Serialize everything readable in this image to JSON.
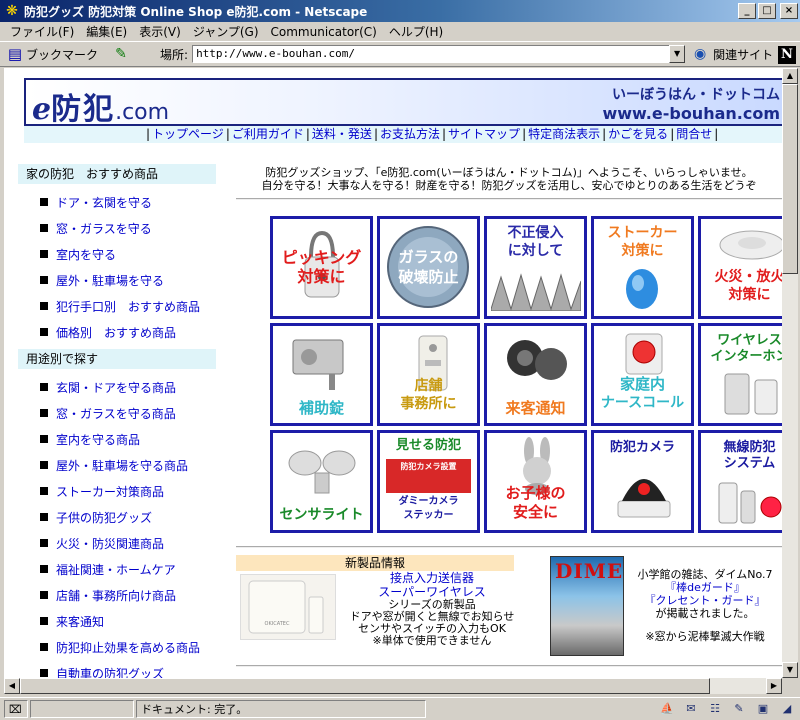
{
  "window": {
    "title": "防犯グッズ 防犯対策 Online Shop e防犯.com - Netscape",
    "minimize": "_",
    "maximize": "□",
    "close": "×"
  },
  "menu": [
    "ファイル(F)",
    "編集(E)",
    "表示(V)",
    "ジャンプ(G)",
    "Communicator(C)",
    "ヘルプ(H)"
  ],
  "toolbar": {
    "bookmarks_label": "ブックマーク",
    "location_label": "場所:",
    "url": "http://www.e-bouhan.com/",
    "related_label": "関連サイト",
    "brand_logo": "N"
  },
  "status": {
    "text": "ドキュメント: 完了。"
  },
  "page": {
    "logo_e": "e",
    "logo_kanji": "防犯",
    "logo_com": ".com",
    "header_kana": "いーぼうはん・ドットコム",
    "header_url": "www.e-bouhan.com",
    "nav": [
      "トップページ",
      "ご利用ガイド",
      "送料・発送",
      "お支払方法",
      "サイトマップ",
      "特定商法表示",
      "かごを見る",
      "問合せ"
    ],
    "welcome_line1": "防犯グッズショップ、「e防犯.com(いーぼうはん・ドットコム)」へようこそ、いらっしゃいませ。",
    "welcome_line2": "自分を守る！大事な人を守る！財産を守る！防犯グッズを活用し、安心でゆとりのある生活をどうぞ",
    "sidebar": {
      "sec1_title": "家の防犯　おすすめ商品",
      "sec1_items": [
        "ドア・玄関を守る",
        "窓・ガラスを守る",
        "室内を守る",
        "屋外・駐車場を守る",
        "犯行手口別　おすすめ商品",
        "価格別　おすすめ商品"
      ],
      "sec2_title": "用途別で探す",
      "sec2_items": [
        "玄関・ドアを守る商品",
        "窓・ガラスを守る商品",
        "室内を守る商品",
        "屋外・駐車場を守る商品",
        "ストーカー対策商品",
        "子供の防犯グッズ",
        "火災・防災関連商品",
        "福祉関連・ホームケア",
        "店舗・事務所向け商品",
        "来客通知",
        "防犯抑止効果を高める商品",
        "自動車の防犯グッズ"
      ]
    },
    "tiles": [
      {
        "line1": "ピッキング",
        "line2": "対策に"
      },
      {
        "line1": "ガラスの",
        "line2": "破壊防止"
      },
      {
        "line1": "不正侵入",
        "line2": "に対して"
      },
      {
        "line1": "ストーカー",
        "line2": "対策に"
      },
      {
        "line1": "火災・放火",
        "line2": "対策に"
      },
      {
        "line1": "補助錠",
        "line2": ""
      },
      {
        "line1": "店舗",
        "line2": "事務所に"
      },
      {
        "line1": "来客通知",
        "line2": ""
      },
      {
        "line1": "家庭内",
        "line2": "ナースコール"
      },
      {
        "line1": "ワイヤレス",
        "line2": "インターホン"
      },
      {
        "line1": "センサライト",
        "line2": ""
      },
      {
        "line1": "見せる防犯",
        "line2": "ダミーカメラ",
        "line3": "ステッカー",
        "label_small": "防犯カメラ設置"
      },
      {
        "line1": "お子様の",
        "line2": "安全に"
      },
      {
        "line1": "防犯カメラ",
        "line2": ""
      },
      {
        "line1": "無線防犯",
        "line2": "システム"
      }
    ],
    "new_product": {
      "header": "新製品情報",
      "link1": "接点入力送信器",
      "link2": "スーパーワイヤレス",
      "line3": "シリーズの新製品",
      "line4": "ドアや窓が開くと無線でお知らせ",
      "line5": "センサやスイッチの入力もOK",
      "line6": "※単体で使用できません",
      "brand": "OKICATEC"
    },
    "magazine": {
      "cover_title": "DIME",
      "line1": "小学館の雑誌、ダイムNo.7",
      "link1": "『棒deガード』",
      "link2": "『クレセント・ガード』",
      "line4": "が掲載されました。",
      "line5": "※窓から泥棒撃滅大作戦"
    }
  },
  "colors": {
    "title_bar": "#0a246a",
    "link": "#0000cc",
    "tile_border": "#1c1ca8",
    "header_navy": "#1b2a8c",
    "section_bg": "#dff4f9"
  }
}
